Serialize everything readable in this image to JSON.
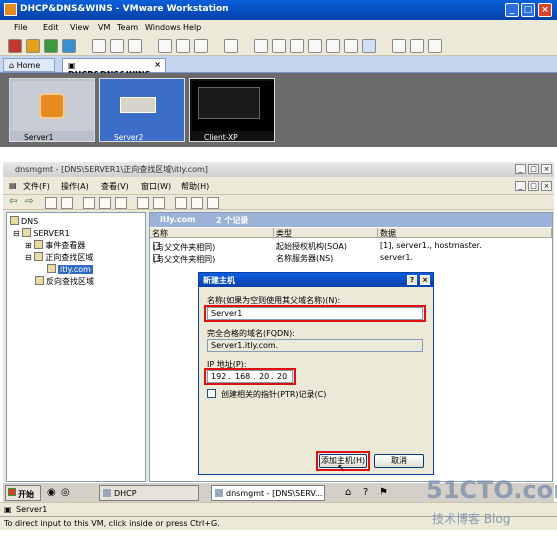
{
  "vm": {
    "title": "DHCP&DNS&WINS - VMware Workstation",
    "menu": [
      "File",
      "Edit",
      "View",
      "VM",
      "Team",
      "Windows",
      "Help"
    ],
    "tabs": {
      "home": "Home",
      "active": "DHCP&DNS&WINS"
    },
    "thumbnails": [
      "Server1",
      "Server2",
      "Client-XP"
    ],
    "status_vm": "Server1",
    "status_hint": "To direct input to this VM, click inside or press Ctrl+G."
  },
  "mmc": {
    "title": "dnsmgmt - [DNS\\SERVER1\\正向查找区域\\itly.com]",
    "menu": [
      "文件(F)",
      "操作(A)",
      "查看(V)",
      "窗口(W)",
      "帮助(H)"
    ],
    "tree": {
      "root": "DNS",
      "server": "SERVER1",
      "event_viewer": "事件查看器",
      "forward_zones": "正向查找区域",
      "zone": "itly.com",
      "reverse_zones": "反向查找区域"
    },
    "pane_header": {
      "zone": "itly.com",
      "count": "2 个记录"
    },
    "columns": [
      "名称",
      "类型",
      "数据"
    ],
    "records": [
      {
        "name": "(与父文件夹相同)",
        "type": "起始授权机构(SOA)",
        "data": "[1], server1., hostmaster."
      },
      {
        "name": "(与父文件夹相同)",
        "type": "名称服务器(NS)",
        "data": "server1."
      }
    ]
  },
  "dialog": {
    "title": "新建主机",
    "name_label": "名称(如果为空则使用其父域名称)(N):",
    "name_value": "Server1",
    "fqdn_label": "完全合格的域名(FQDN):",
    "fqdn_value": "Server1.itly.com.",
    "ip_label": "IP 地址(P):",
    "ip": [
      "192",
      "168",
      "20",
      "20"
    ],
    "ptr_label": "创建相关的指针(PTR)记录(C)",
    "add_button": "添加主机(H)",
    "cancel_button": "取消"
  },
  "taskbar": {
    "start": "开始",
    "items": [
      "DHCP",
      "dnsmgmt - [DNS\\SERV..."
    ]
  },
  "watermark": {
    "site": "51CTO.com",
    "blog": "技术博客 Blog"
  }
}
